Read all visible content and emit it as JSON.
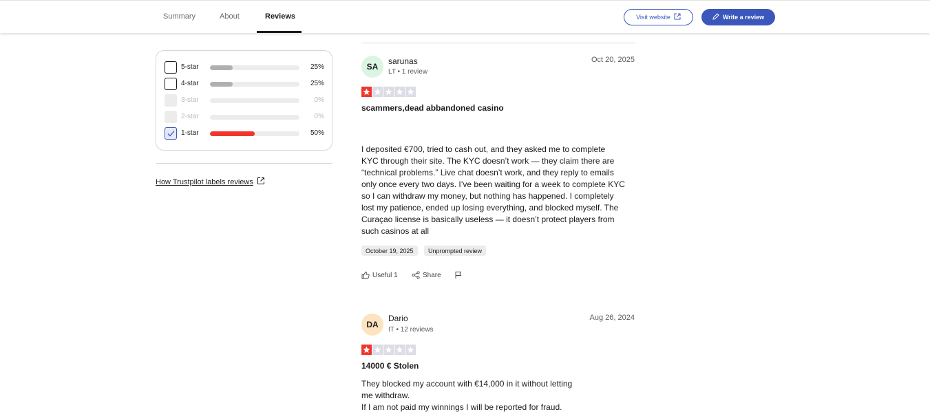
{
  "nav": {
    "tabs": [
      {
        "label": "Summary",
        "active": false
      },
      {
        "label": "About",
        "active": false
      },
      {
        "label": "Reviews",
        "active": true
      }
    ],
    "visit_website": "Visit website",
    "write_review": "Write a review"
  },
  "colors": {
    "brand_blue": "#3c57bc",
    "bar_gray": "#b0b0b0",
    "bar_red": "#f2352c",
    "star_red": "#f2352c",
    "star_empty": "#dcdce6"
  },
  "filters": [
    {
      "label": "5-star",
      "percent": "25%",
      "fill": 0.25,
      "checked": false,
      "disabled": false
    },
    {
      "label": "4-star",
      "percent": "25%",
      "fill": 0.25,
      "checked": false,
      "disabled": false
    },
    {
      "label": "3-star",
      "percent": "0%",
      "fill": 0,
      "checked": false,
      "disabled": true
    },
    {
      "label": "2-star",
      "percent": "0%",
      "fill": 0,
      "checked": false,
      "disabled": true
    },
    {
      "label": "1-star",
      "percent": "50%",
      "fill": 0.5,
      "checked": true,
      "disabled": false
    }
  ],
  "how_link": "How Trustpilot labels reviews",
  "reviews": [
    {
      "initials": "SA",
      "avatar_color": "#dcf5e3",
      "name": "sarunas",
      "meta": "LT • 1 review",
      "date": "Oct 20, 2025",
      "rating": 1,
      "title": "scammers,dead abbandoned casino",
      "body": "I deposited €700, tried to cash out, and they asked me to complete\nKYC through their site. The KYC doesn’t work — they claim there are\n“technical problems.” Live chat doesn’t work, and they reply to emails\nonly once every two days. I’ve been waiting for a week to complete KYC\nso I can withdraw my money, but nothing has happened. I completely\nlost my patience, ended up losing everything, and blocked myself. The\nCuraçao license is basically useless — it doesn’t protect players from\nsuch casinos at all",
      "experience_date": "October 19, 2025",
      "tag": "Unprompted review",
      "useful": "Useful 1",
      "share": "Share"
    },
    {
      "initials": "DA",
      "avatar_color": "#fde3bf",
      "name": "Dario",
      "meta": "IT • 12 reviews",
      "date": "Aug 26, 2024",
      "rating": 1,
      "title": "14000 € Stolen",
      "body": "They blocked my account with €14,000 in it without letting\nme withdraw.\nIf I am not paid my winnings I will be reported for fraud."
    }
  ]
}
